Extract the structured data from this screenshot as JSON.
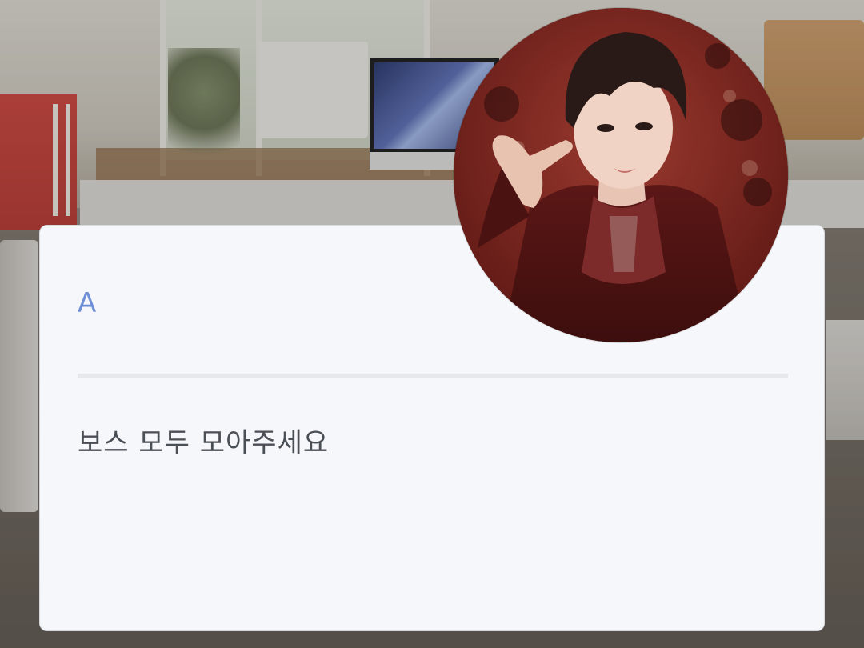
{
  "background": {
    "scene": "office"
  },
  "dialogue_box": {
    "speaker": "A",
    "text": "보스 모두 모아주세요"
  },
  "avatar": {
    "icon": "character-portrait"
  },
  "colors": {
    "speaker_name": "#6f8fd6",
    "dialogue_text": "#4a4e55",
    "card_background": "#f5f7fa"
  }
}
